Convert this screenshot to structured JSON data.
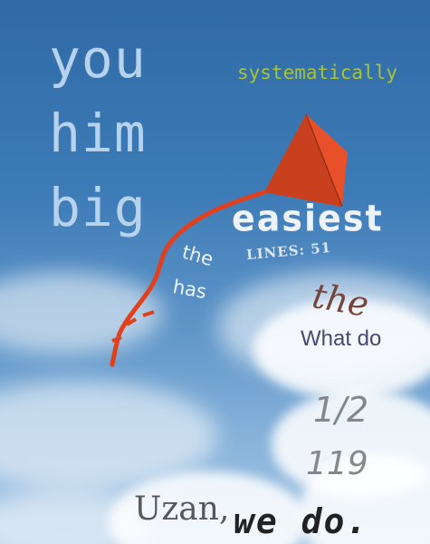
{
  "words": {
    "you": "you",
    "him": "him",
    "big": "big",
    "systematically": "systematically",
    "easiest": "easiest",
    "lines": "LINES: 51",
    "the_small": "the",
    "has": "has",
    "the_script": "the",
    "what_do": "What do",
    "fraction": "1/2",
    "number": "119",
    "uzan": "Uzan,",
    "we_do": "we do."
  },
  "colors": {
    "sky_top": "#2f6aa6",
    "sky_bottom": "#a8c8e6",
    "kite": "#e8502a",
    "kite_shadow": "#b8361a",
    "tail": "#e0401e"
  }
}
